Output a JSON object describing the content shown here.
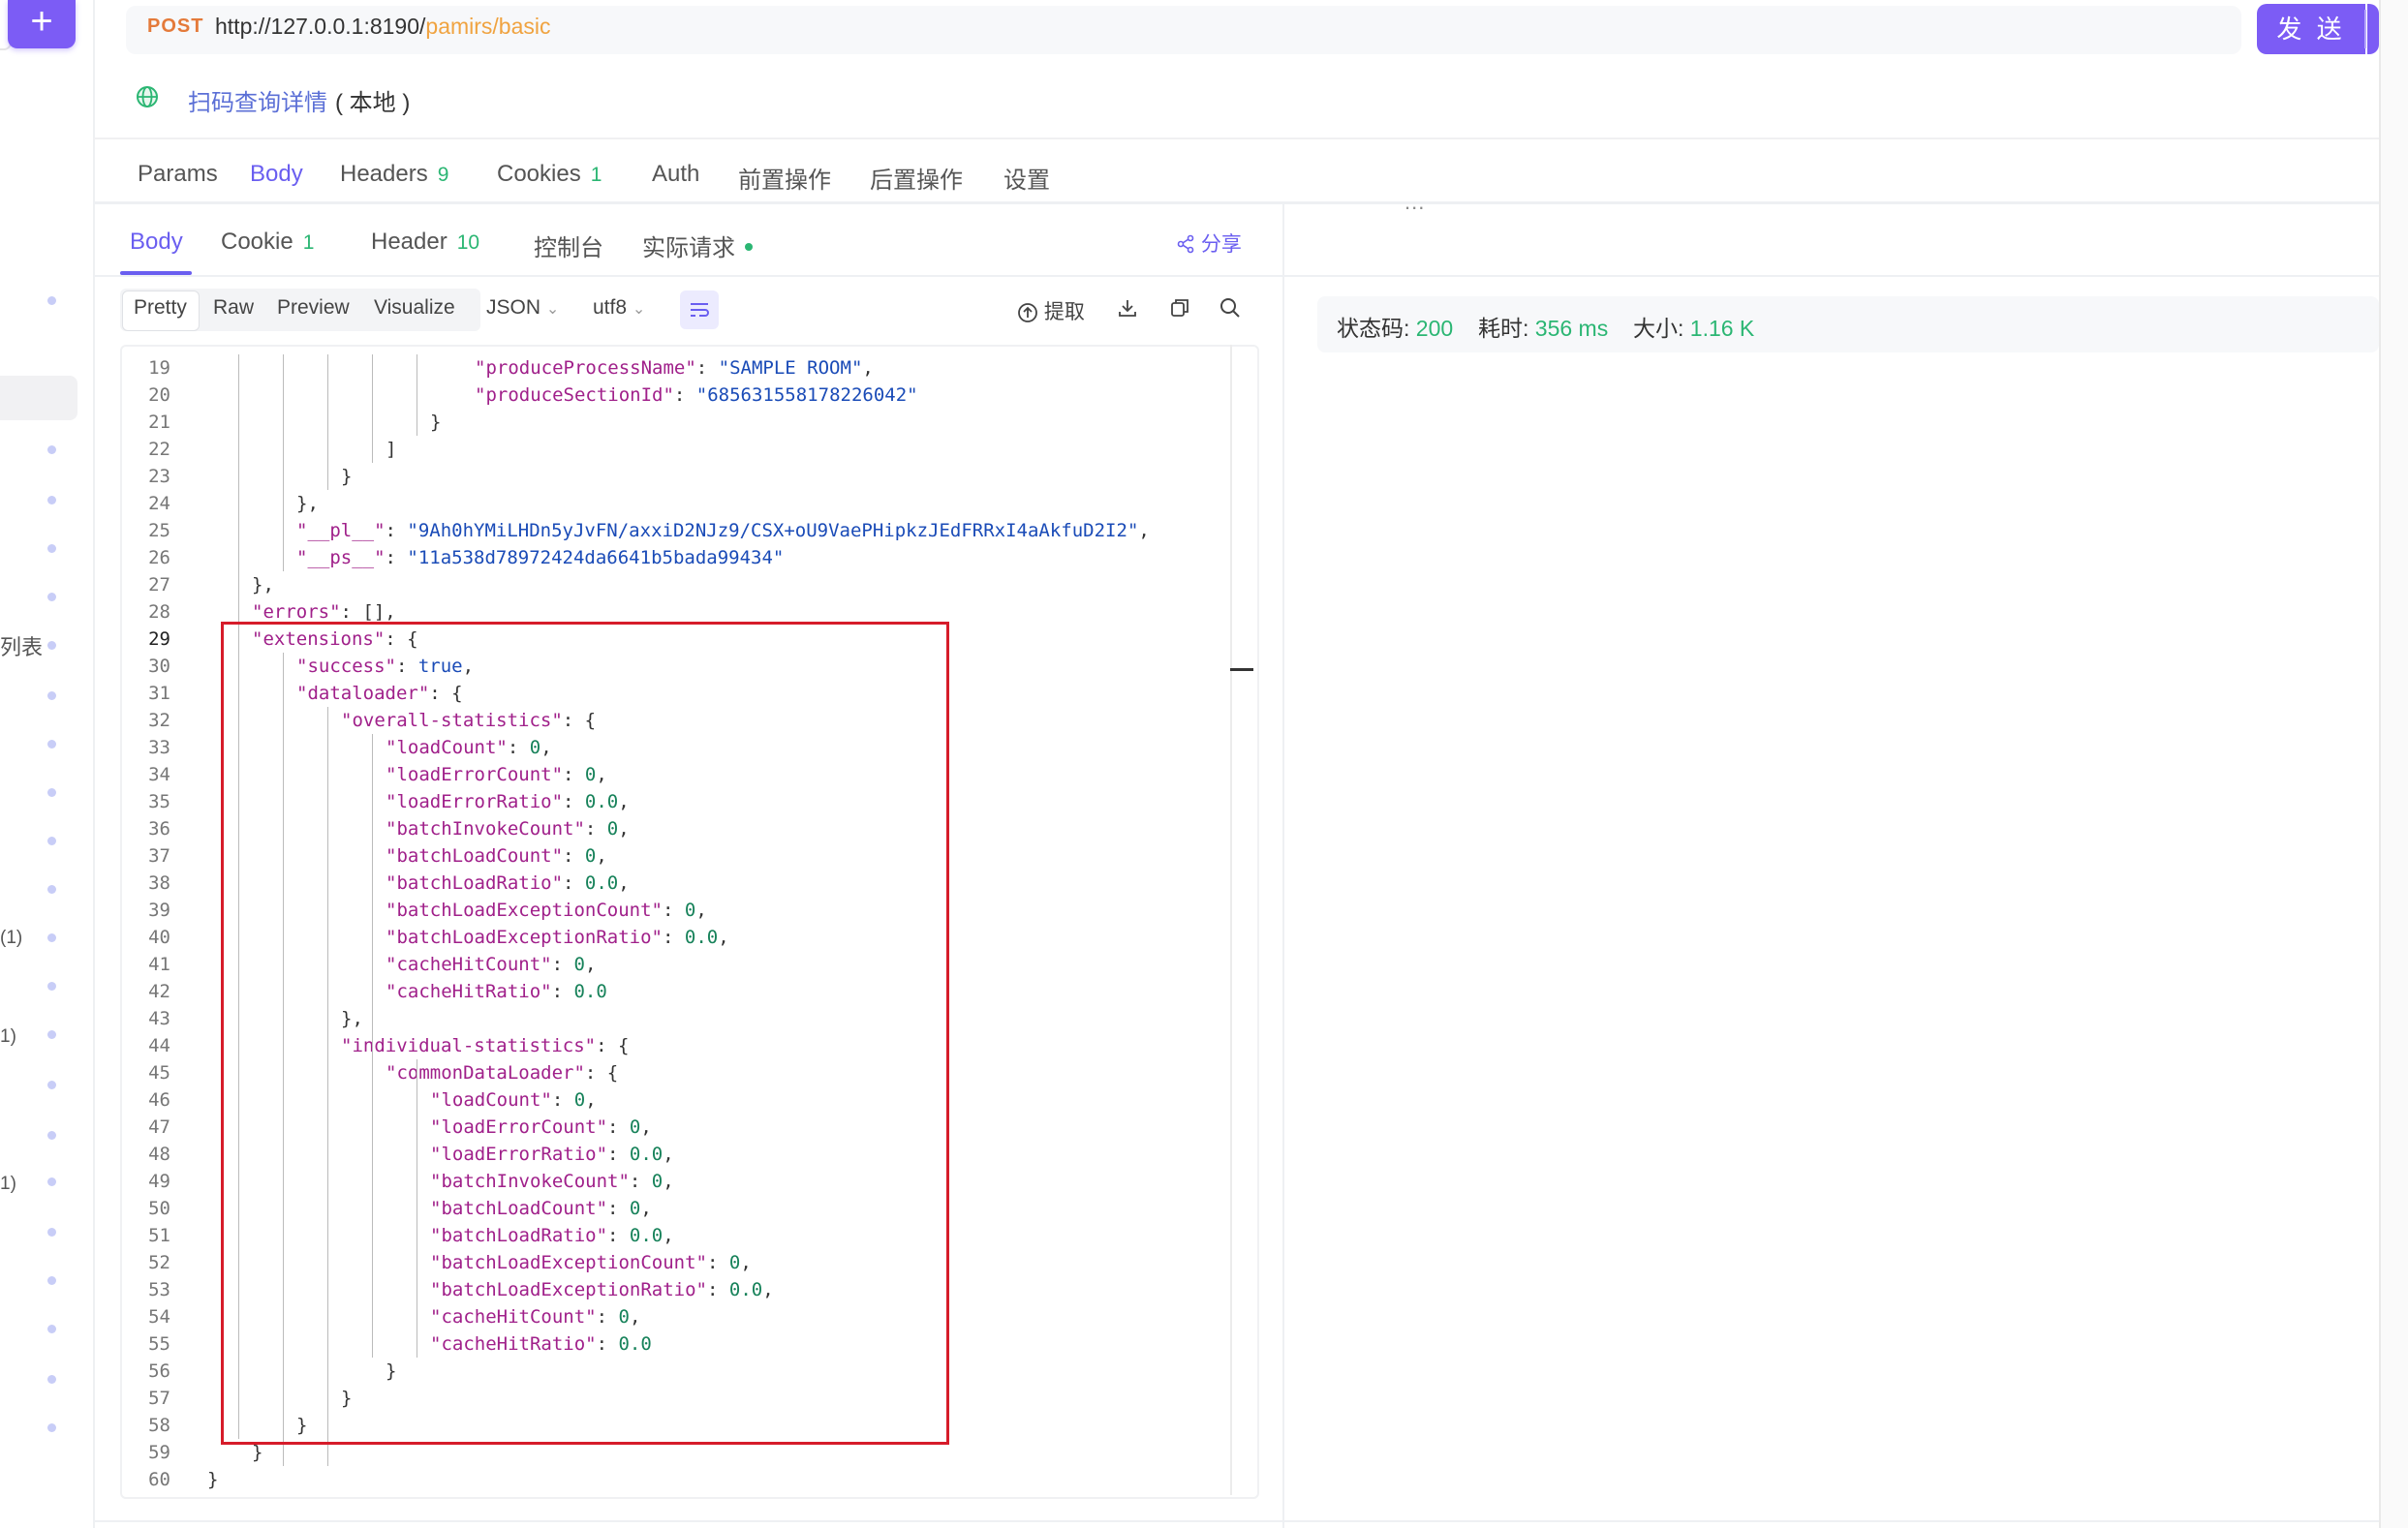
{
  "request": {
    "method": "POST",
    "url_base": "http://127.0.0.1:8190/",
    "url_path": "pamirs/basic",
    "send_label": "发 送"
  },
  "api": {
    "name": "扫码查询详情",
    "env": "( 本地 )"
  },
  "request_tabs": [
    {
      "label": "Params",
      "badge": ""
    },
    {
      "label": "Body",
      "badge": ""
    },
    {
      "label": "Headers",
      "badge": "9"
    },
    {
      "label": "Cookies",
      "badge": "1"
    },
    {
      "label": "Auth",
      "badge": ""
    },
    {
      "label": "前置操作",
      "badge": ""
    },
    {
      "label": "后置操作",
      "badge": ""
    },
    {
      "label": "设置",
      "badge": ""
    }
  ],
  "panel_handle": "...",
  "response_tabs": [
    {
      "label": "Body",
      "badge": ""
    },
    {
      "label": "Cookie",
      "badge": "1"
    },
    {
      "label": "Header",
      "badge": "10"
    },
    {
      "label": "控制台",
      "badge": ""
    },
    {
      "label": "实际请求",
      "badge": ""
    }
  ],
  "share_label": "分享",
  "view_modes": [
    "Pretty",
    "Raw",
    "Preview",
    "Visualize"
  ],
  "format_select": "JSON",
  "encoding_select": "utf8",
  "extract_label": "提取",
  "status": {
    "code_label": "状态码:",
    "code": "200",
    "time_label": "耗时:",
    "time": "356 ms",
    "size_label": "大小:",
    "size": "1.16 K"
  },
  "sidebar_fragments": [
    "列表",
    "(1)",
    "1)",
    "1)"
  ],
  "code_lines": [
    {
      "n": 19,
      "indent": 6,
      "t": "\"produceProcessName\": \"SAMPLE ROOM\","
    },
    {
      "n": 20,
      "indent": 6,
      "t": "\"produceSectionId\": \"685631558178226042\""
    },
    {
      "n": 21,
      "indent": 5,
      "t": "}"
    },
    {
      "n": 22,
      "indent": 4,
      "t": "]"
    },
    {
      "n": 23,
      "indent": 3,
      "t": "}"
    },
    {
      "n": 24,
      "indent": 2,
      "t": "},"
    },
    {
      "n": 25,
      "indent": 2,
      "t": "\"__pl__\": \"9Ah0hYMiLHDn5yJvFN/axxiD2NJz9/CSX+oU9VaePHipkzJEdFRRxI4aAkfuD2I2\","
    },
    {
      "n": 26,
      "indent": 2,
      "t": "\"__ps__\": \"11a538d78972424da6641b5bada99434\""
    },
    {
      "n": 27,
      "indent": 1,
      "t": "},"
    },
    {
      "n": 28,
      "indent": 1,
      "t": "\"errors\": [],"
    },
    {
      "n": 29,
      "indent": 1,
      "t": "\"extensions\": {"
    },
    {
      "n": 30,
      "indent": 2,
      "t": "\"success\": true,"
    },
    {
      "n": 31,
      "indent": 2,
      "t": "\"dataloader\": {"
    },
    {
      "n": 32,
      "indent": 3,
      "t": "\"overall-statistics\": {"
    },
    {
      "n": 33,
      "indent": 4,
      "t": "\"loadCount\": 0,"
    },
    {
      "n": 34,
      "indent": 4,
      "t": "\"loadErrorCount\": 0,"
    },
    {
      "n": 35,
      "indent": 4,
      "t": "\"loadErrorRatio\": 0.0,"
    },
    {
      "n": 36,
      "indent": 4,
      "t": "\"batchInvokeCount\": 0,"
    },
    {
      "n": 37,
      "indent": 4,
      "t": "\"batchLoadCount\": 0,"
    },
    {
      "n": 38,
      "indent": 4,
      "t": "\"batchLoadRatio\": 0.0,"
    },
    {
      "n": 39,
      "indent": 4,
      "t": "\"batchLoadExceptionCount\": 0,"
    },
    {
      "n": 40,
      "indent": 4,
      "t": "\"batchLoadExceptionRatio\": 0.0,"
    },
    {
      "n": 41,
      "indent": 4,
      "t": "\"cacheHitCount\": 0,"
    },
    {
      "n": 42,
      "indent": 4,
      "t": "\"cacheHitRatio\": 0.0"
    },
    {
      "n": 43,
      "indent": 3,
      "t": "},"
    },
    {
      "n": 44,
      "indent": 3,
      "t": "\"individual-statistics\": {"
    },
    {
      "n": 45,
      "indent": 4,
      "t": "\"commonDataLoader\": {"
    },
    {
      "n": 46,
      "indent": 5,
      "t": "\"loadCount\": 0,"
    },
    {
      "n": 47,
      "indent": 5,
      "t": "\"loadErrorCount\": 0,"
    },
    {
      "n": 48,
      "indent": 5,
      "t": "\"loadErrorRatio\": 0.0,"
    },
    {
      "n": 49,
      "indent": 5,
      "t": "\"batchInvokeCount\": 0,"
    },
    {
      "n": 50,
      "indent": 5,
      "t": "\"batchLoadCount\": 0,"
    },
    {
      "n": 51,
      "indent": 5,
      "t": "\"batchLoadRatio\": 0.0,"
    },
    {
      "n": 52,
      "indent": 5,
      "t": "\"batchLoadExceptionCount\": 0,"
    },
    {
      "n": 53,
      "indent": 5,
      "t": "\"batchLoadExceptionRatio\": 0.0,"
    },
    {
      "n": 54,
      "indent": 5,
      "t": "\"cacheHitCount\": 0,"
    },
    {
      "n": 55,
      "indent": 5,
      "t": "\"cacheHitRatio\": 0.0"
    },
    {
      "n": 56,
      "indent": 4,
      "t": "}"
    },
    {
      "n": 57,
      "indent": 3,
      "t": "}"
    },
    {
      "n": 58,
      "indent": 2,
      "t": "}"
    },
    {
      "n": 59,
      "indent": 1,
      "t": "}"
    },
    {
      "n": 60,
      "indent": 0,
      "t": "}"
    }
  ],
  "current_line": 29,
  "colors": {
    "accent": "#7c5cf5",
    "tab_active": "#6a5ef0",
    "success": "#2bb673",
    "highlight_box": "#d61c2a"
  }
}
